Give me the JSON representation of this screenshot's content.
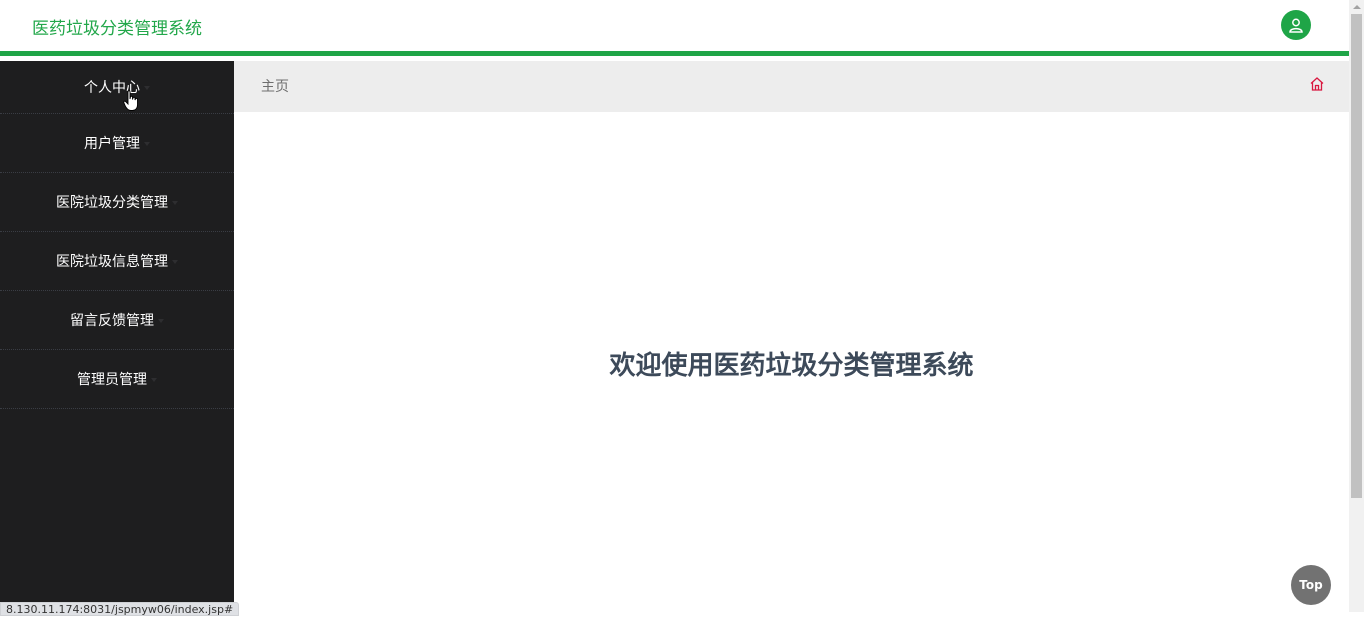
{
  "header": {
    "title": "医药垃圾分类管理系统",
    "avatar_icon": "user-icon",
    "accent_color": "#1fa547"
  },
  "sidebar": {
    "items": [
      {
        "label": "个人中心"
      },
      {
        "label": "用户管理"
      },
      {
        "label": "医院垃圾分类管理"
      },
      {
        "label": "医院垃圾信息管理"
      },
      {
        "label": "留言反馈管理"
      },
      {
        "label": "管理员管理"
      }
    ]
  },
  "breadcrumb": {
    "current": "主页",
    "home_icon": "home-icon"
  },
  "main": {
    "welcome": "欢迎使用医药垃圾分类管理系统"
  },
  "top_button": {
    "label": "Top"
  },
  "status_bar": {
    "url": "8.130.11.174:8031/jspmyw06/index.jsp#"
  }
}
